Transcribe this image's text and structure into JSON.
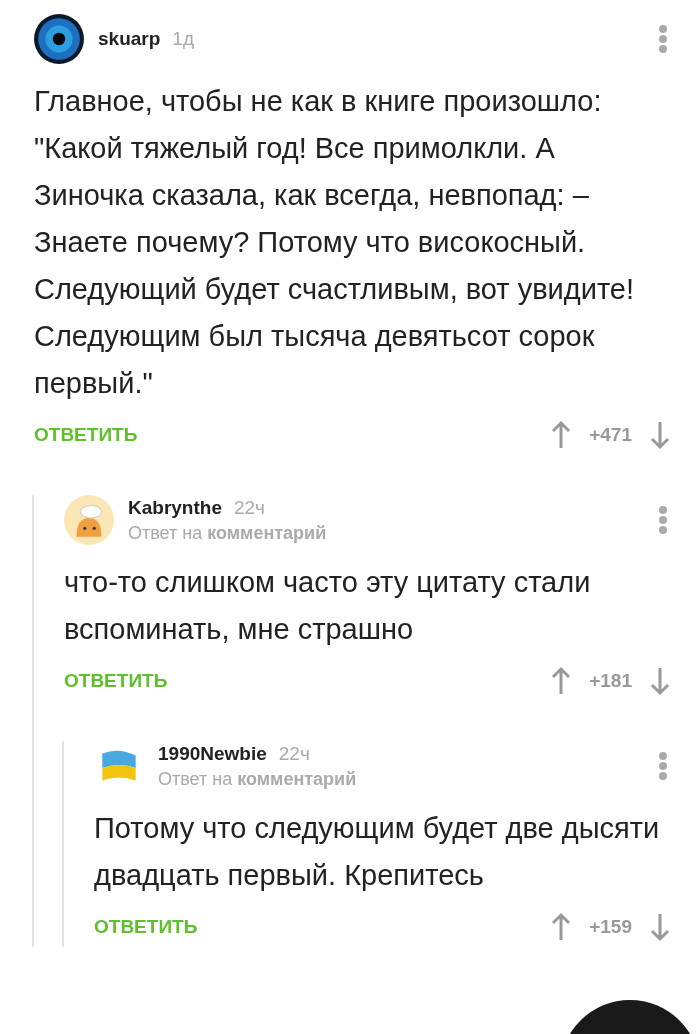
{
  "comments": [
    {
      "author": "skuarp",
      "time": "1д",
      "kind": "eye",
      "text": "Главное, чтобы не как в книге произошло: \"Какой тяжелый год! Все примолкли. А Зиночка сказала, как всегда, невпопад: – Знаете почему? Потому что високосный. Следующий будет счастливым, вот увидите! Следующим был тысяча девятьсот сорок первый.\"",
      "reply_label": "ОТВЕТИТЬ",
      "score": "+471",
      "children": [
        {
          "author": "Kabrynthe",
          "time": "22ч",
          "kind": "chef",
          "reply_to": "Ответ на **комментарий**",
          "text": "что-то слишком часто эту цитату стали вспоминать, мне страшно",
          "reply_label": "ОТВЕТИТЬ",
          "score": "+181",
          "children": [
            {
              "author": "1990Newbie",
              "time": "22ч",
              "kind": "flag",
              "reply_to": "Ответ на **комментарий**",
              "text": "Потому что следующим будет две дысяти двадцать первый. Крепитесь",
              "reply_label": "ОТВЕТИТЬ",
              "score": "+159"
            }
          ]
        }
      ]
    }
  ]
}
